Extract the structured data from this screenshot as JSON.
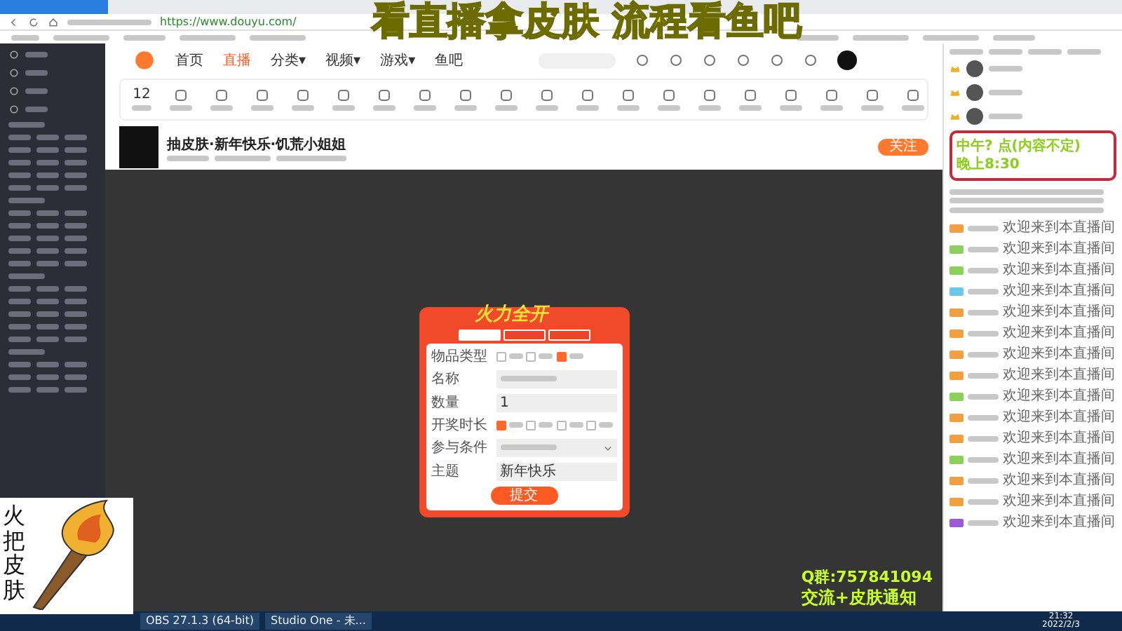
{
  "overlay_title": "看直播拿皮肤 流程看鱼吧",
  "browser": {
    "url": "https://www.douyu.com/"
  },
  "nav": [
    {
      "label": "首页",
      "selected": false
    },
    {
      "label": "直播",
      "selected": true
    },
    {
      "label": "分类▾",
      "selected": false
    },
    {
      "label": "视频▾",
      "selected": false
    },
    {
      "label": "游戏▾",
      "selected": false
    },
    {
      "label": "鱼吧",
      "selected": false
    }
  ],
  "toolbar": {
    "count": "12"
  },
  "stream": {
    "title": "抽皮肤·新年快乐·饥荒小姐姐",
    "follow": "关注"
  },
  "dialog": {
    "banner": "火力全开",
    "tabs": [
      {
        "selected": true
      },
      {
        "selected": false
      },
      {
        "selected": false
      }
    ],
    "fields": [
      {
        "kind": "options",
        "label": "物品类型",
        "options": [
          {
            "checked": false
          },
          {
            "checked": false
          },
          {
            "checked": true
          }
        ]
      },
      {
        "kind": "input",
        "label": "名称"
      },
      {
        "kind": "input",
        "label": "数量",
        "value": "1"
      },
      {
        "kind": "options",
        "label": "开奖时长",
        "options": [
          {
            "checked": true
          },
          {
            "checked": false
          },
          {
            "checked": false
          },
          {
            "checked": false
          }
        ]
      },
      {
        "kind": "select",
        "label": "参与条件"
      },
      {
        "kind": "input",
        "label": "主题",
        "value": "新年快乐"
      }
    ],
    "submit": "提交"
  },
  "note": {
    "lines": [
      "中午? 点(内容不定)",
      "晚上8:30"
    ]
  },
  "chat": {
    "messages": [
      {
        "color": "#f0a040",
        "text": "欢迎来到本直播间"
      },
      {
        "color": "#8ccf5a",
        "text": "欢迎来到本直播间"
      },
      {
        "color": "#8ccf5a",
        "text": "欢迎来到本直播间"
      },
      {
        "color": "#6cc8e8",
        "text": "欢迎来到本直播间"
      },
      {
        "color": "#f0a040",
        "text": "欢迎来到本直播间"
      },
      {
        "color": "#f0a040",
        "text": "欢迎来到本直播间"
      },
      {
        "color": "#f0a040",
        "text": "欢迎来到本直播间"
      },
      {
        "color": "#f0a040",
        "text": "欢迎来到本直播间"
      },
      {
        "color": "#8ccf5a",
        "text": "欢迎来到本直播间"
      },
      {
        "color": "#f0a040",
        "text": "欢迎来到本直播间"
      },
      {
        "color": "#f0a040",
        "text": "欢迎来到本直播间"
      },
      {
        "color": "#8ccf5a",
        "text": "欢迎来到本直播间"
      },
      {
        "color": "#f0a040",
        "text": "欢迎来到本直播间"
      },
      {
        "color": "#f0a040",
        "text": "欢迎来到本直播间"
      },
      {
        "color": "#9b59d6",
        "text": "欢迎来到本直播间"
      }
    ]
  },
  "logo_text": "火把皮肤",
  "promo": {
    "qq": "Q群:757841094",
    "note": "交流+皮肤通知"
  },
  "taskbar": {
    "items": [
      "OBS 27.1.3 (64-bit)",
      "Studio One - 未..."
    ],
    "time": "21:32",
    "date": "2022/2/3"
  }
}
